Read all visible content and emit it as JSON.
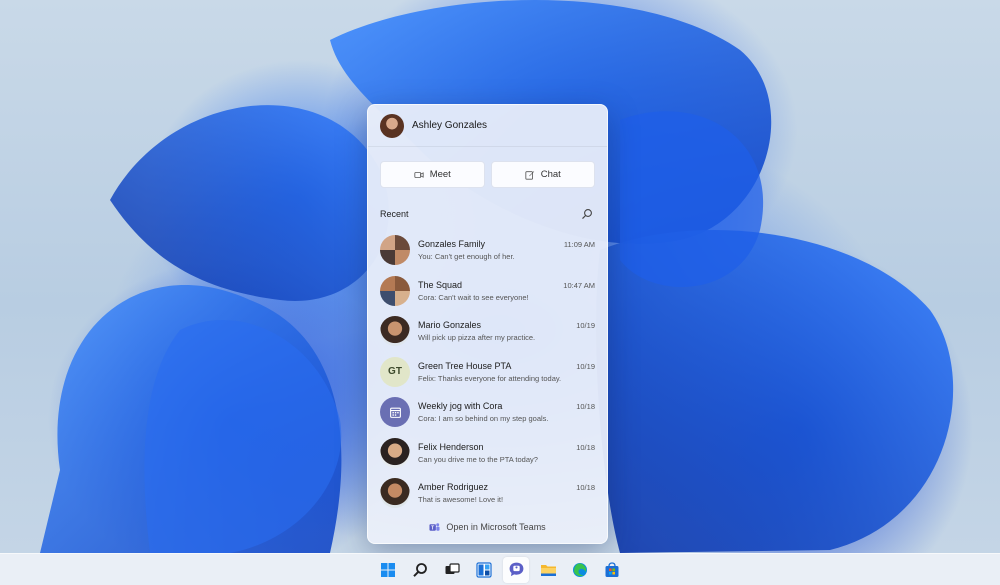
{
  "profile": {
    "name": "Ashley Gonzales"
  },
  "actions": {
    "meet_label": "Meet",
    "chat_label": "Chat"
  },
  "recent": {
    "label": "Recent"
  },
  "chats": [
    {
      "name": "Gonzales Family",
      "time": "11:09 AM",
      "preview": "You: Can't get enough of her."
    },
    {
      "name": "The Squad",
      "time": "10:47 AM",
      "preview": "Cora: Can't wait to see everyone!"
    },
    {
      "name": "Mario Gonzales",
      "time": "10/19",
      "preview": "Will pick up pizza after my practice."
    },
    {
      "name": "Green Tree House PTA",
      "time": "10/19",
      "preview": "Felix: Thanks everyone for attending today.",
      "initials": "GT"
    },
    {
      "name": "Weekly jog with Cora",
      "time": "10/18",
      "preview": "Cora: I am so behind on my step goals."
    },
    {
      "name": "Felix Henderson",
      "time": "10/18",
      "preview": "Can you drive me to the PTA today?"
    },
    {
      "name": "Amber Rodriguez",
      "time": "10/18",
      "preview": "That is awesome! Love it!"
    }
  ],
  "footer": {
    "open_teams_label": "Open in Microsoft Teams"
  },
  "taskbar": {
    "items": [
      "start-icon",
      "search-icon",
      "task-view-icon",
      "widgets-icon",
      "chat-icon",
      "file-explorer-icon",
      "edge-icon",
      "store-icon"
    ],
    "active": "chat-icon"
  },
  "colors": {
    "accent": "#5b5fc7",
    "wallpaper": "#1a5ce0"
  }
}
